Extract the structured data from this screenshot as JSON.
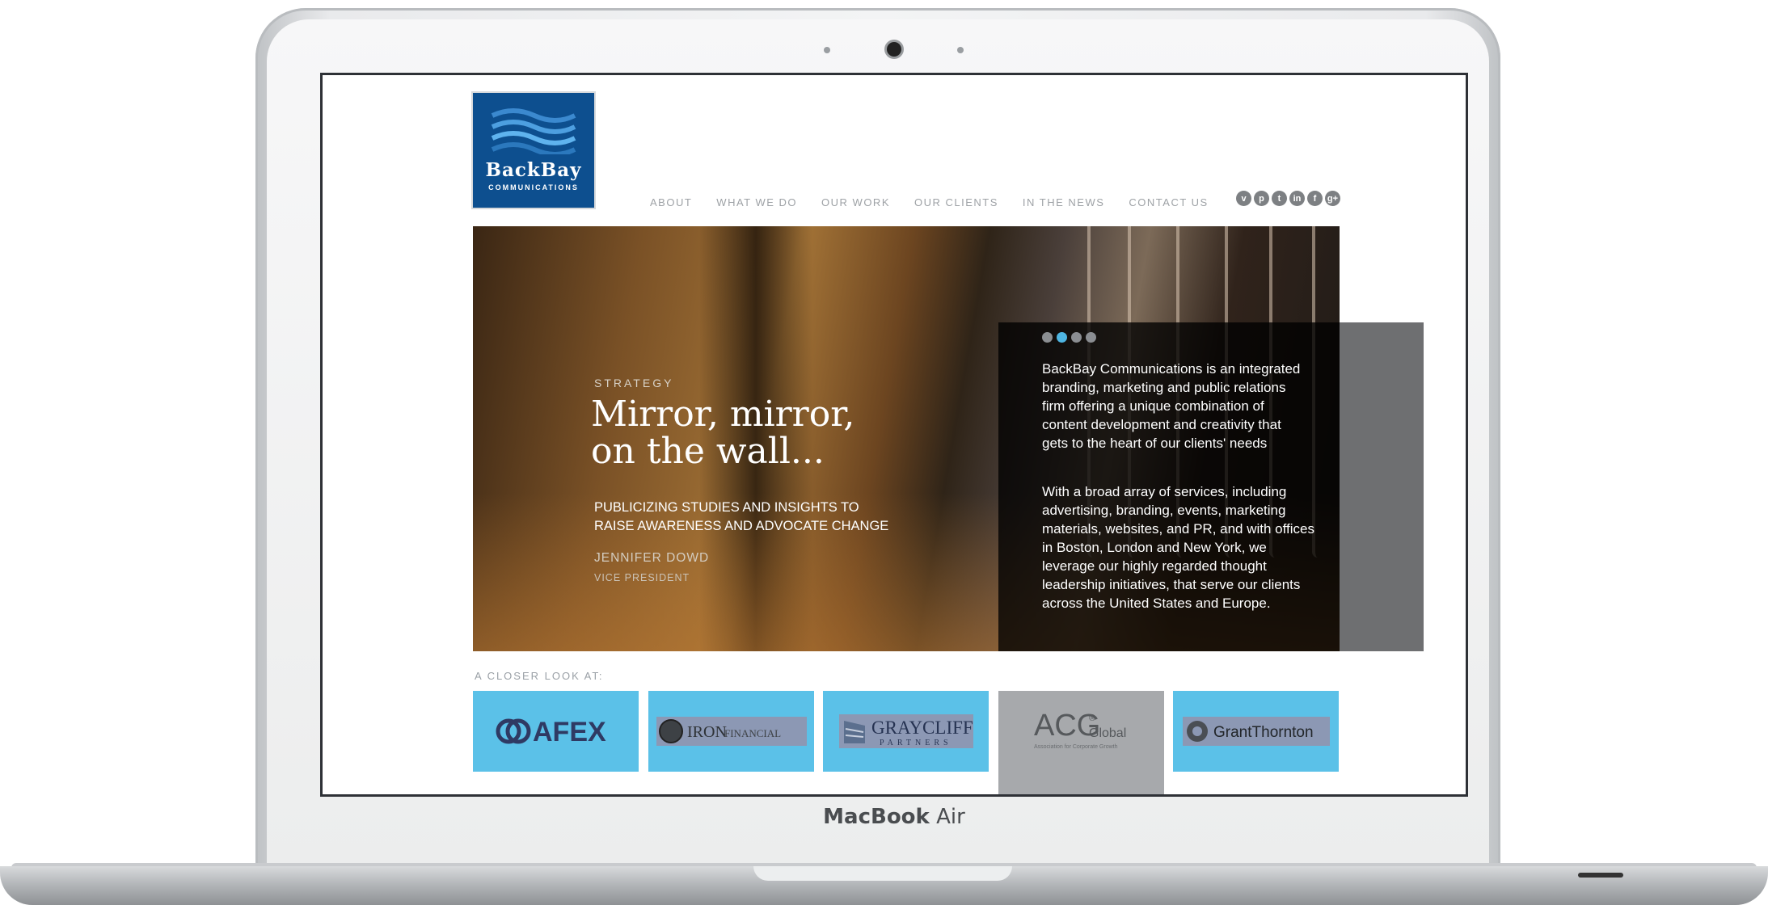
{
  "device": {
    "label_bold": "MacBook",
    "label_light": " Air"
  },
  "site": {
    "logo": {
      "word": "BackBay",
      "sub": "COMMUNICATIONS"
    },
    "nav": [
      "ABOUT",
      "WHAT WE DO",
      "OUR WORK",
      "OUR CLIENTS",
      "IN THE NEWS",
      "CONTACT US"
    ],
    "social": [
      {
        "icon": "vimeo-icon",
        "glyph": "v"
      },
      {
        "icon": "pinterest-icon",
        "glyph": "p"
      },
      {
        "icon": "twitter-icon",
        "glyph": "t"
      },
      {
        "icon": "linkedin-icon",
        "glyph": "in"
      },
      {
        "icon": "facebook-icon",
        "glyph": "f"
      },
      {
        "icon": "google-plus-icon",
        "glyph": "g+"
      }
    ],
    "hero": {
      "tag": "STRATEGY",
      "title": "Mirror, mirror, on the wall...",
      "tagline": "PUBLICIZING STUDIES AND INSIGHTS TO RAISE AWARENESS AND ADVOCATE CHANGE",
      "person": "JENNIFER DOWD",
      "role": "VICE PRESIDENT"
    },
    "panel": {
      "slides": 4,
      "active_slide": 2,
      "p1": "BackBay Communications is an integrated branding, marketing and public relations firm offering a unique combination of content development and creativity that gets to the heart of our clients' needs",
      "p2": "With a broad array of services, including advertising, branding, events, marketing materials, websites, and PR, and with offices in Boston, London and New York, we leverage our highly regarded thought leadership initiatives, that serve our clients across the United States and Europe."
    },
    "closer_label": "A CLOSER LOOK AT:",
    "clients": [
      {
        "name": "AFEX",
        "active": false
      },
      {
        "name": "IRON",
        "name2": "FINANCIAL",
        "active": false
      },
      {
        "name": "GRAYCLIFF",
        "name2": "PARTNERS",
        "active": false
      },
      {
        "name": "ACG",
        "name2": "Global",
        "tagline": "Association for Corporate Growth",
        "active": true
      },
      {
        "name": "GrantThornton",
        "active": false
      }
    ],
    "colors": {
      "logo_blue": "#0d4f8f",
      "client_blue": "#5bc1e8",
      "active_grey": "#a7a9ac",
      "dot_active": "#4eb5e2"
    }
  }
}
